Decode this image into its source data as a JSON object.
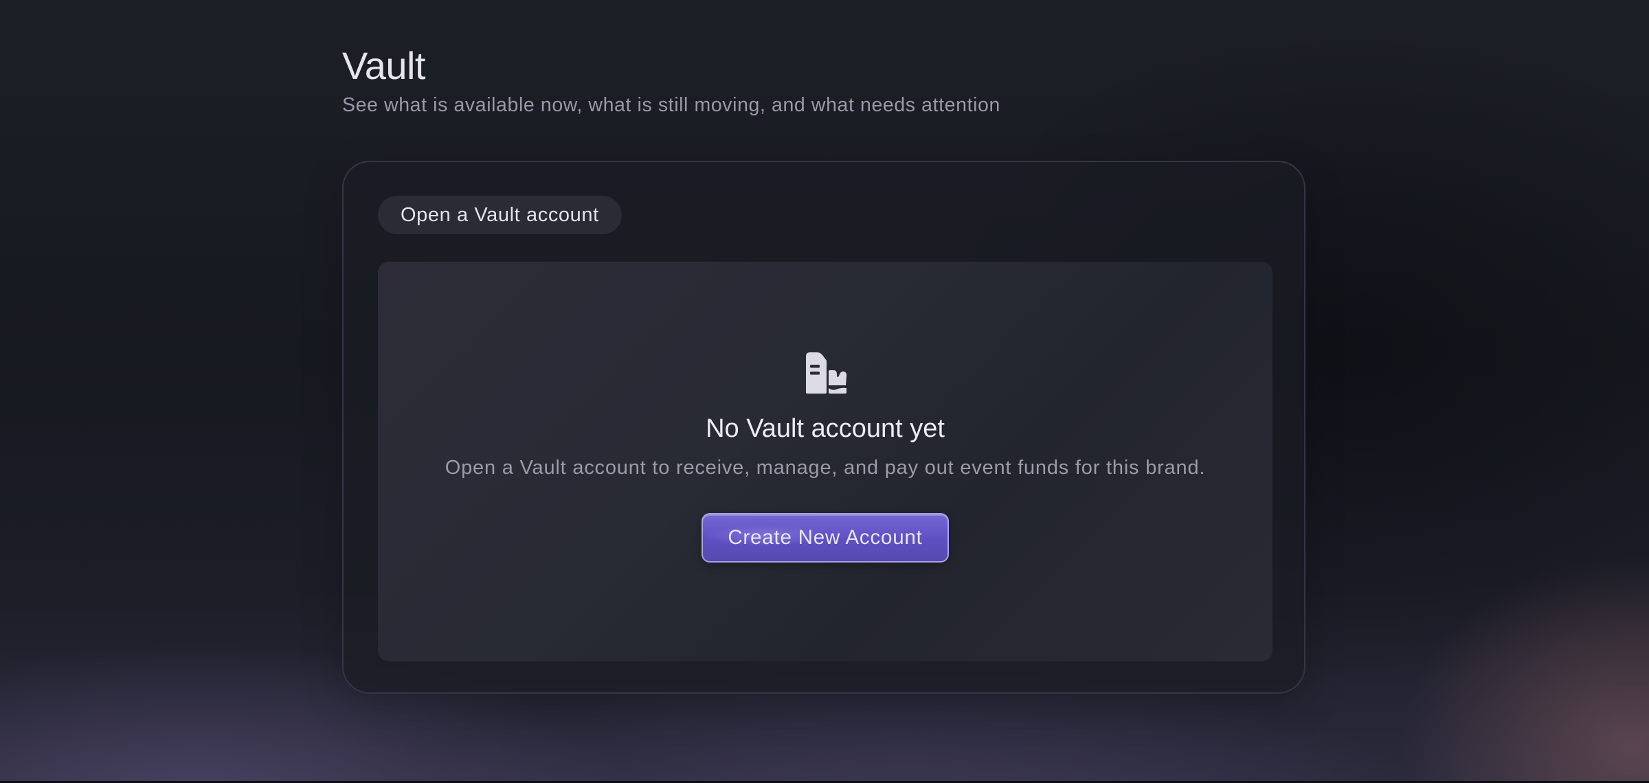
{
  "header": {
    "title": "Vault",
    "subtitle": "See what is available now, what is still moving, and what needs attention"
  },
  "card": {
    "tab_label": "Open a Vault account",
    "empty_state": {
      "icon": "bank-building-icon",
      "title": "No Vault account yet",
      "description": "Open a Vault account to receive, manage, and pay out event funds for this brand.",
      "button_label": "Create New Account"
    }
  },
  "colors": {
    "accent": "#5e52c6",
    "accent_border": "#a9a2e6",
    "background": "#1a1b22"
  }
}
